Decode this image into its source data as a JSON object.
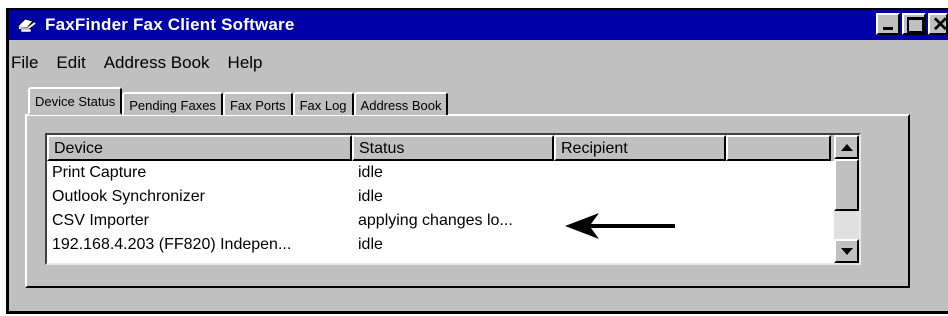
{
  "window": {
    "title": "FaxFinder Fax Client Software",
    "icon": "fax-app-icon"
  },
  "menu": [
    "File",
    "Edit",
    "Address Book",
    "Help"
  ],
  "tabs": [
    "Device Status",
    "Pending Faxes",
    "Fax Ports",
    "Fax Log",
    "Address Book"
  ],
  "active_tab": "Device Status",
  "table": {
    "columns": [
      "Device",
      "Status",
      "Recipient",
      ""
    ],
    "rows": [
      {
        "device": "Print Capture",
        "status": "idle"
      },
      {
        "device": "Outlook Synchronizer",
        "status": "idle"
      },
      {
        "device": "CSV Importer",
        "status": "applying changes lo..."
      },
      {
        "device": "192.168.4.203 (FF820) Indepen...",
        "status": "idle"
      }
    ]
  },
  "annotation": {
    "icon": "left-arrow-icon",
    "points_to_row": 3
  }
}
